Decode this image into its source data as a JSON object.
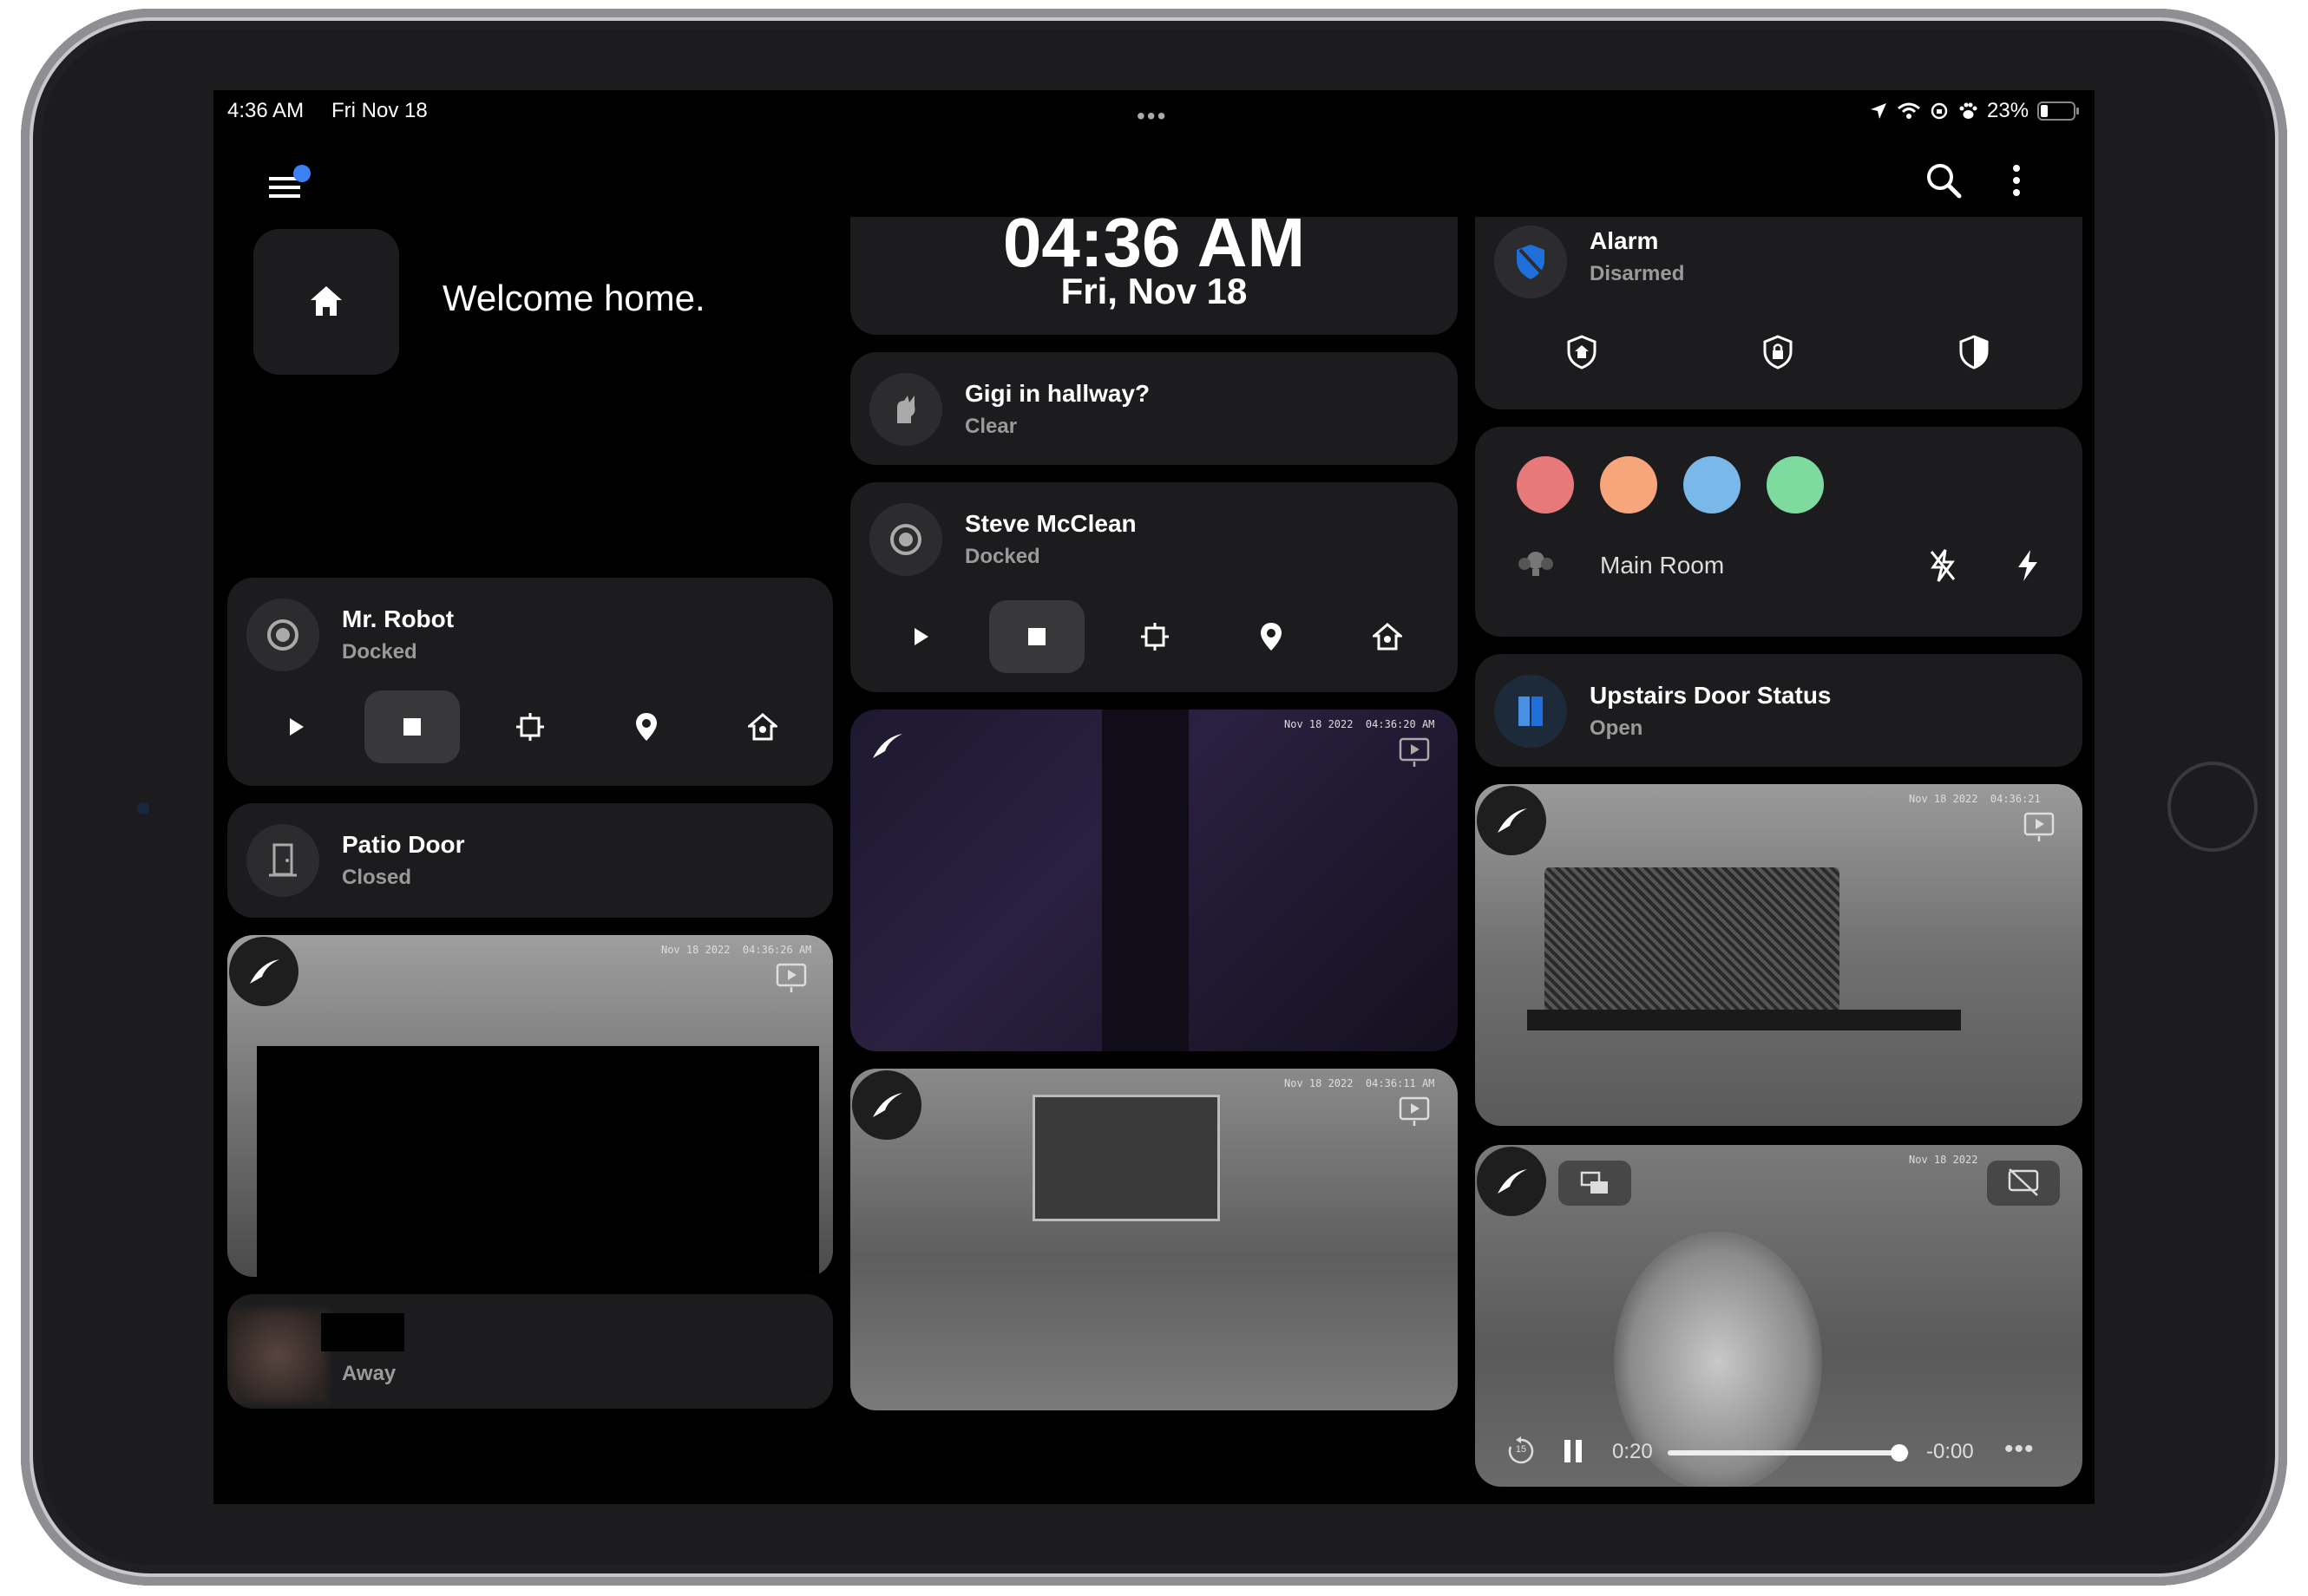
{
  "status_bar": {
    "time": "4:36 AM",
    "date": "Fri Nov 18",
    "battery": "23%"
  },
  "welcome": {
    "text": "Welcome home."
  },
  "clock": {
    "time": "04:36 AM",
    "date": "Fri, Nov 18"
  },
  "vacuum_robot": {
    "name": "Mr. Robot",
    "state": "Docked"
  },
  "patio_door": {
    "name": "Patio Door",
    "state": "Closed"
  },
  "cat_sensor": {
    "name": "Gigi in hallway?",
    "state": "Clear"
  },
  "vacuum_steve": {
    "name": "Steve McClean",
    "state": "Docked"
  },
  "alarm": {
    "name": "Alarm",
    "state": "Disarmed"
  },
  "lights": {
    "room": "Main Room",
    "colors": [
      "#e8797a",
      "#f7a57a",
      "#7bb8ea",
      "#7ddba0"
    ]
  },
  "upstairs_door": {
    "name": "Upstairs Door Status",
    "state": "Open"
  },
  "person": {
    "state": "Away"
  },
  "cameras": {
    "living": {
      "timestamp": "Nov 18 2022  04:36:26 AM"
    },
    "purple": {
      "timestamp": "Nov 18 2022  04:36:20 AM"
    },
    "bedroom": {
      "timestamp": "Nov 18 2022  04:36:11 AM"
    },
    "office": {
      "timestamp": "Nov 18 2022  04:36:21"
    },
    "hall": {
      "timestamp": "Nov 18 2022"
    }
  },
  "player": {
    "elapsed": "0:20",
    "remaining": "-0:00",
    "skip": "15",
    "progress": 0.96
  }
}
